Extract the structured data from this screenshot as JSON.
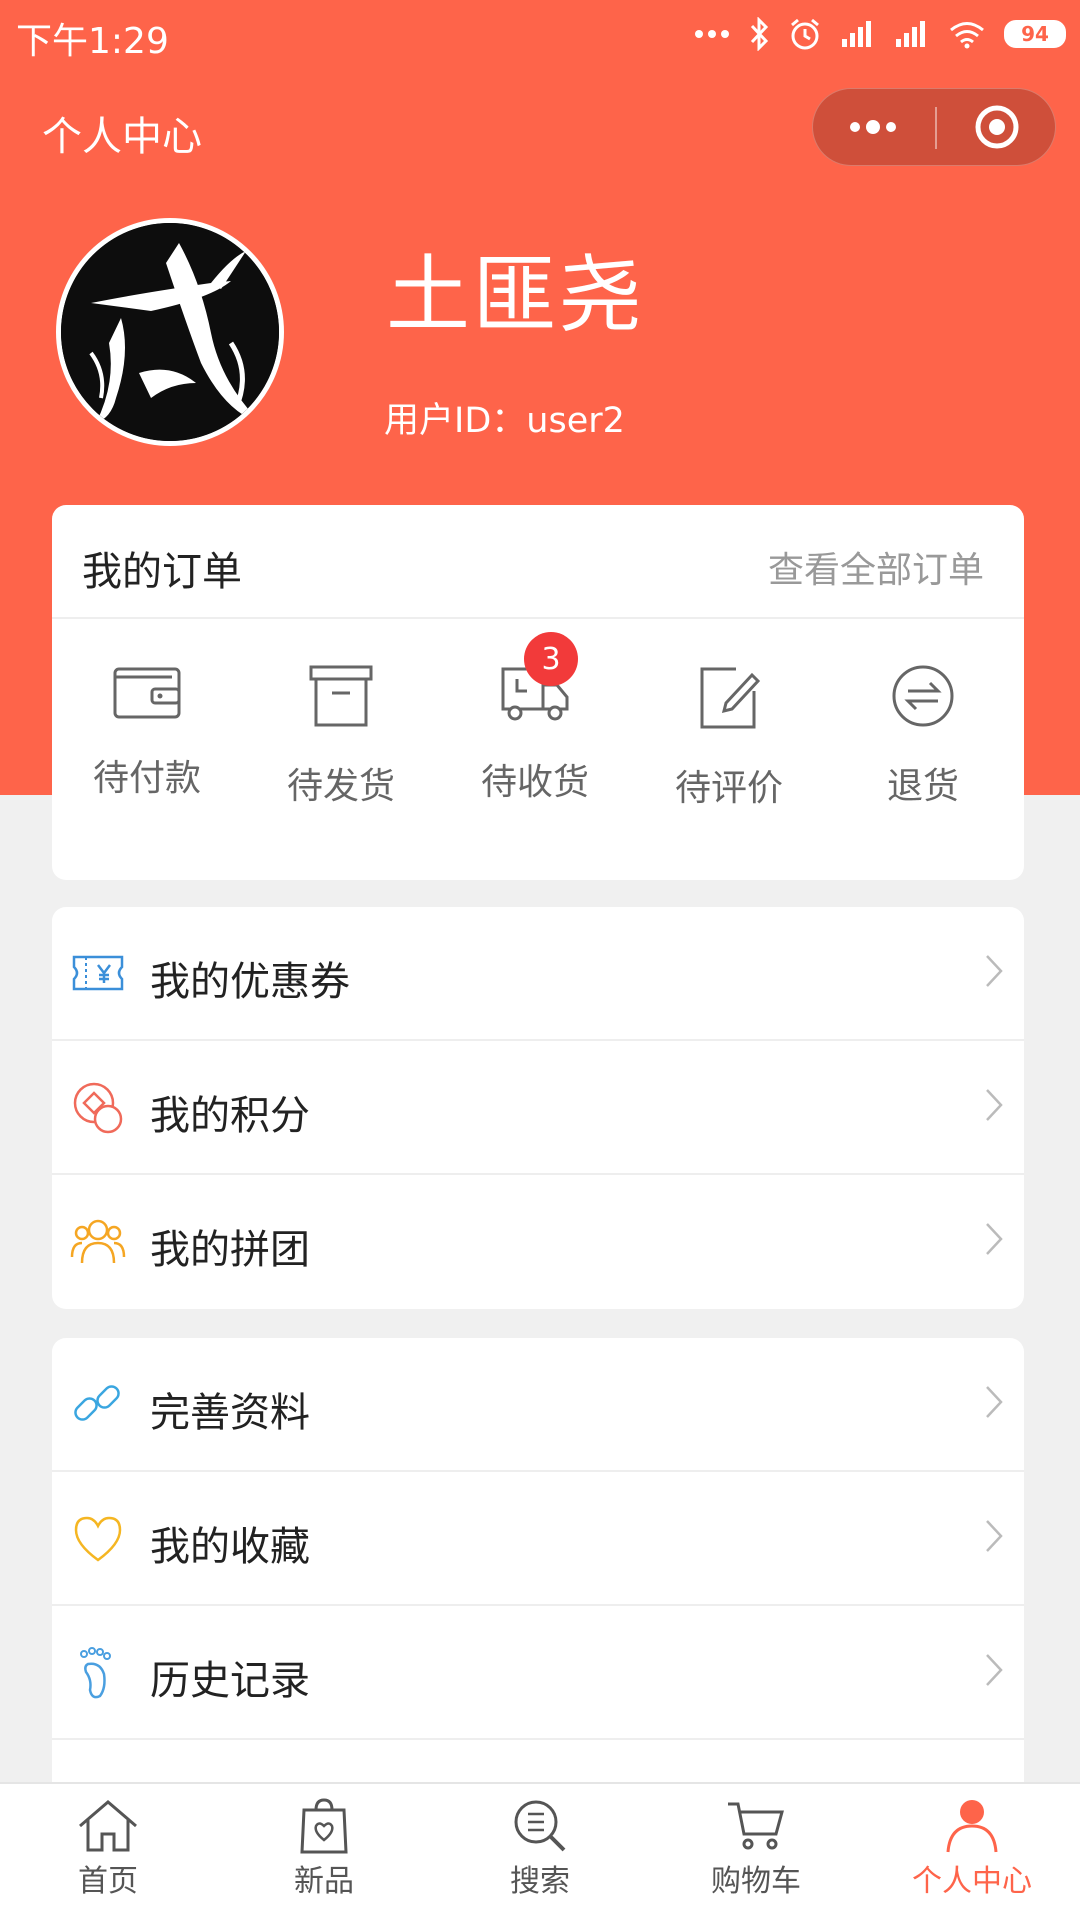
{
  "status_bar": {
    "time": "下午1:29",
    "battery": "94"
  },
  "header": {
    "title": "个人中心"
  },
  "user": {
    "name": "土匪尧",
    "id_text": "用户ID：user2"
  },
  "orders": {
    "title": "我的订单",
    "view_all": "查看全部订单",
    "items": [
      {
        "label": "待付款",
        "icon": "wallet-icon"
      },
      {
        "label": "待发货",
        "icon": "box-icon"
      },
      {
        "label": "待收货",
        "icon": "truck-icon",
        "badge": "3"
      },
      {
        "label": "待评价",
        "icon": "edit-icon"
      },
      {
        "label": "退货",
        "icon": "return-icon"
      }
    ]
  },
  "menu_group1": [
    {
      "label": "我的优惠券",
      "icon": "coupon-icon",
      "color": "#3b8fd9"
    },
    {
      "label": "我的积分",
      "icon": "points-icon",
      "color": "#f06a5a"
    },
    {
      "label": "我的拼团",
      "icon": "group-icon",
      "color": "#f5a623"
    }
  ],
  "menu_group2": [
    {
      "label": "完善资料",
      "icon": "link-icon",
      "color": "#3aa6e0"
    },
    {
      "label": "我的收藏",
      "icon": "heart-icon",
      "color": "#f5b622"
    },
    {
      "label": "历史记录",
      "icon": "footprint-icon",
      "color": "#4a9fe0"
    }
  ],
  "tabbar": [
    {
      "label": "首页",
      "icon": "home-icon"
    },
    {
      "label": "新品",
      "icon": "shopping-bag-icon"
    },
    {
      "label": "搜索",
      "icon": "search-icon"
    },
    {
      "label": "购物车",
      "icon": "cart-icon"
    },
    {
      "label": "个人中心",
      "icon": "profile-icon",
      "active": true
    }
  ],
  "colors": {
    "brand": "#fe644a",
    "badge": "#f23a3a"
  }
}
